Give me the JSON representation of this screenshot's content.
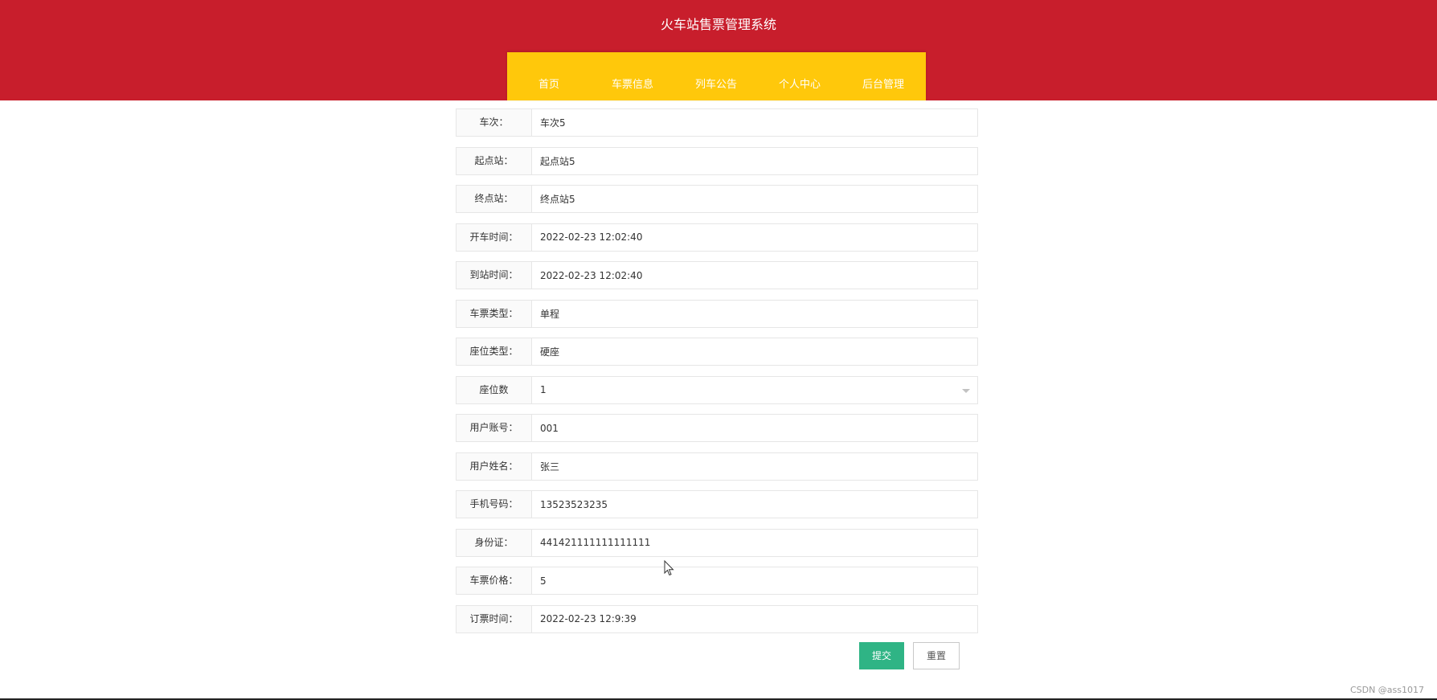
{
  "site": {
    "title": "火车站售票管理系统"
  },
  "nav": {
    "items": [
      {
        "label": "首页"
      },
      {
        "label": "车票信息"
      },
      {
        "label": "列车公告"
      },
      {
        "label": "个人中心"
      },
      {
        "label": "后台管理"
      }
    ]
  },
  "form": {
    "fields": [
      {
        "label": "车次：",
        "value": "车次5"
      },
      {
        "label": "起点站：",
        "value": "起点站5"
      },
      {
        "label": "终点站：",
        "value": "终点站5"
      },
      {
        "label": "开车时间：",
        "value": "2022-02-23 12:02:40"
      },
      {
        "label": "到站时间：",
        "value": "2022-02-23 12:02:40"
      },
      {
        "label": "车票类型：",
        "value": "单程"
      },
      {
        "label": "座位类型：",
        "value": "硬座"
      },
      {
        "label": "座位数",
        "value": "1"
      },
      {
        "label": "用户账号：",
        "value": "001"
      },
      {
        "label": "用户姓名：",
        "value": "张三"
      },
      {
        "label": "手机号码：",
        "value": "13523523235"
      },
      {
        "label": "身份证：",
        "value": "441421111111111111"
      },
      {
        "label": "车票价格：",
        "value": "5"
      },
      {
        "label": "订票时间：",
        "value": "2022-02-23 12:9:39"
      }
    ]
  },
  "actions": {
    "submit_label": "提交",
    "reset_label": "重置"
  },
  "footer": {
    "watermark": "CSDN @ass1017"
  },
  "colors": {
    "header_bg": "#c81e2c",
    "nav_bg": "#ffc80b",
    "submit_bg": "#2fb485"
  }
}
